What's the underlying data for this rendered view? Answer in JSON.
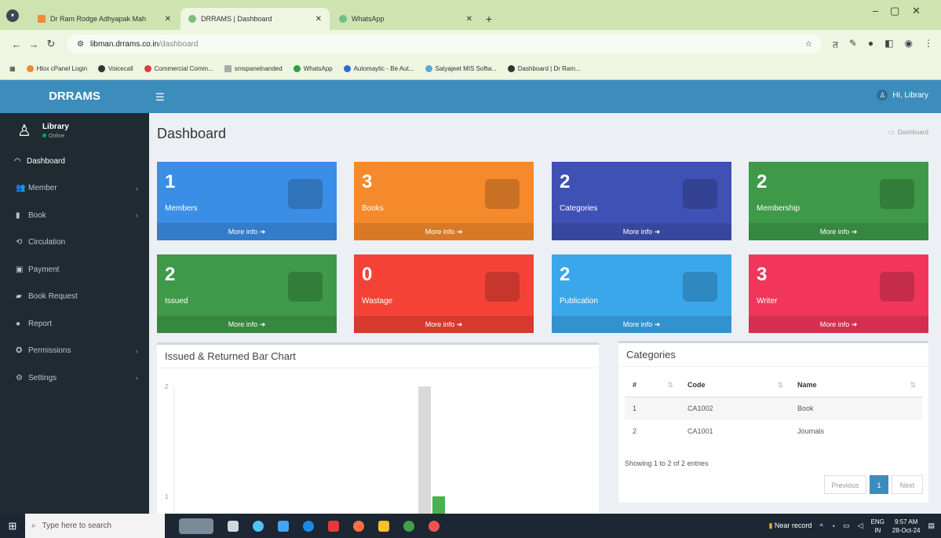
{
  "browser": {
    "tabs": [
      {
        "title": "Dr Ram Rodge Adhyapak Mah"
      },
      {
        "title": "DRRAMS | Dashboard"
      },
      {
        "title": "WhatsApp"
      }
    ],
    "url_host": "libman.drrams.co.in",
    "url_path": "/dashboard",
    "bookmarks": [
      "Hlox cPanel Login",
      "Voicecall",
      "Commercial Comm...",
      "smspanelnanded",
      "WhatsApp",
      "Automaytic - Be Aut...",
      "Satyajeet MIS Softw...",
      "Dashboard | Dr Ram..."
    ]
  },
  "header": {
    "logo": "DRRAMS",
    "user_greeting": "Hi, Library"
  },
  "sidebar": {
    "user_name": "Library",
    "user_status": "Online",
    "items": [
      {
        "label": "Dashboard",
        "icon": "dashboard-icon"
      },
      {
        "label": "Member",
        "icon": "users-icon"
      },
      {
        "label": "Book",
        "icon": "book-icon"
      },
      {
        "label": "Circulation",
        "icon": "circulation-icon"
      },
      {
        "label": "Payment",
        "icon": "money-icon"
      },
      {
        "label": "Book Request",
        "icon": "book-request-icon"
      },
      {
        "label": "Report",
        "icon": "report-icon"
      },
      {
        "label": "Permissions",
        "icon": "permissions-icon"
      },
      {
        "label": "Settings",
        "icon": "settings-icon"
      }
    ]
  },
  "page": {
    "title": "Dashboard",
    "breadcrumb": "Dashboard"
  },
  "stats": [
    {
      "value": "1",
      "label": "Members",
      "more": "More info",
      "color": "#3a8ee6"
    },
    {
      "value": "3",
      "label": "Books",
      "more": "More info",
      "color": "#f58a2c"
    },
    {
      "value": "2",
      "label": "Categories",
      "more": "More info",
      "color": "#3f51b5"
    },
    {
      "value": "2",
      "label": "Membership",
      "more": "More info",
      "color": "#3e9a48"
    },
    {
      "value": "2",
      "label": "Issued",
      "more": "More info",
      "color": "#3e9a48"
    },
    {
      "value": "0",
      "label": "Wastage",
      "more": "More info",
      "color": "#f44336"
    },
    {
      "value": "2",
      "label": "Publication",
      "more": "More info",
      "color": "#3aa7ea"
    },
    {
      "value": "3",
      "label": "Writer",
      "more": "More info",
      "color": "#f2365b"
    }
  ],
  "chart_panel": {
    "title": "Issued & Returned Bar Chart"
  },
  "chart_data": {
    "type": "bar",
    "title": "Issued & Returned Bar Chart",
    "y_ticks": [
      "2",
      "1"
    ],
    "ylim": [
      0,
      2
    ],
    "series": [
      {
        "values": [
          2
        ],
        "color": "#d9d9d9"
      },
      {
        "values": [
          1
        ],
        "color": "#4caf50"
      }
    ]
  },
  "categories": {
    "title": "Categories",
    "columns": [
      "#",
      "Code",
      "Name"
    ],
    "rows": [
      [
        "1",
        "CA1002",
        "Book"
      ],
      [
        "2",
        "CA1001",
        "Journals"
      ]
    ],
    "showing": "Showing 1 to 2 of 2 entries",
    "prev": "Previous",
    "page": "1",
    "next": "Next"
  },
  "taskbar": {
    "search_placeholder": "Type here to search",
    "near_record": "Near record",
    "lang": "ENG",
    "region": "IN",
    "time": "9:57 AM",
    "date": "28-Oct-24"
  }
}
